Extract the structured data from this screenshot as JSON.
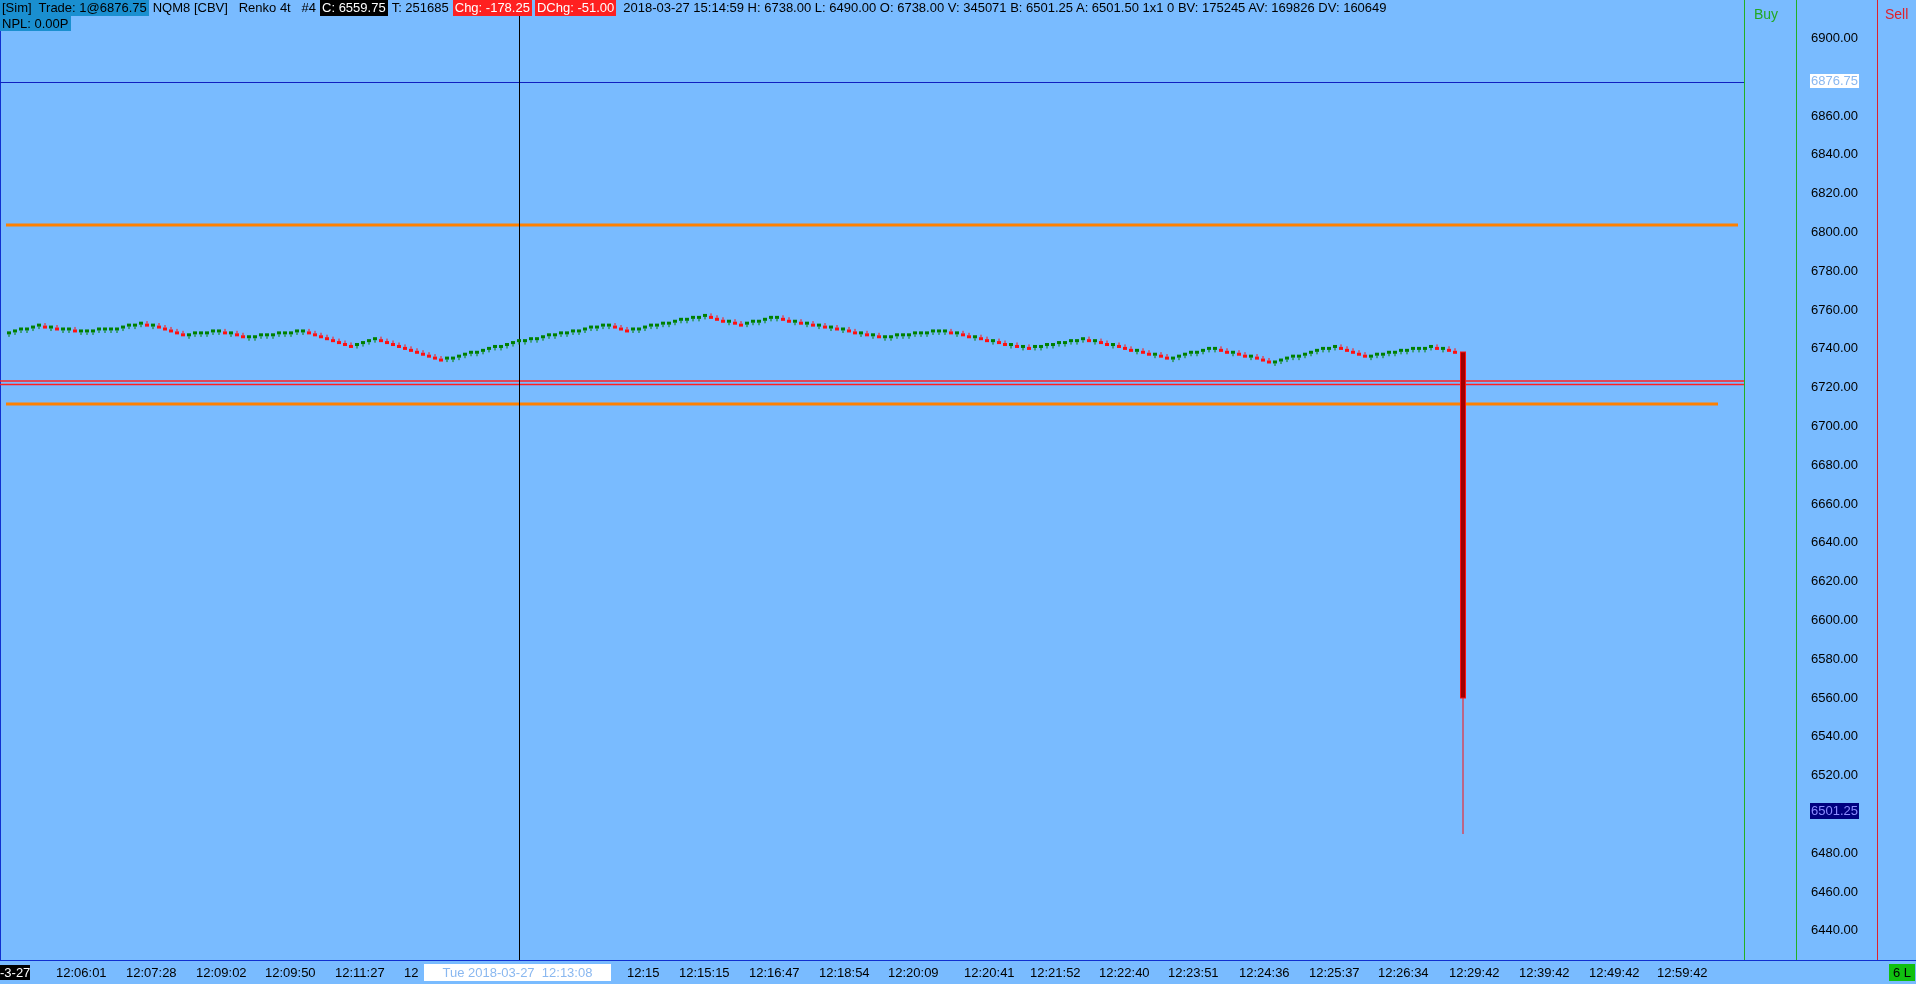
{
  "header": {
    "segments": [
      {
        "kind": "highlight",
        "text": "[Sim]  Trade: 1@6876.75"
      },
      {
        "kind": "plain",
        "text": "NQM8 [CBV]   Renko 4t   #4"
      },
      {
        "kind": "inverse",
        "text": "C: 6559.75"
      },
      {
        "kind": "plain",
        "text": "T: 251685"
      },
      {
        "kind": "alert",
        "text": "Chg: -178.25"
      },
      {
        "kind": "alert",
        "text": "DChg: -51.00"
      },
      {
        "kind": "plain",
        "text": "2018-03-27 15:14:59 H: 6738.00 L: 6490.00 O: 6738.00 V: 345071 B: 6501.25 A: 6501.50 1x1 0 BV: 175245 AV: 169826 DV: 160649"
      }
    ],
    "npl": "NPL: 0.00P"
  },
  "buy_label": "Buy",
  "sell_label": "Sell",
  "price_axis": {
    "labels": [
      "6900.00",
      "6860.00",
      "6840.00",
      "6820.00",
      "6800.00",
      "6780.00",
      "6760.00",
      "6740.00",
      "6720.00",
      "6700.00",
      "6680.00",
      "6660.00",
      "6640.00",
      "6620.00",
      "6600.00",
      "6580.00",
      "6560.00",
      "6540.00",
      "6520.00",
      "6480.00",
      "6460.00",
      "6440.00"
    ],
    "last_trade": "6876.75",
    "bid": "6501.25"
  },
  "time_axis": {
    "date": "-3-27",
    "labels": [
      "12:06:01",
      "12:07:28",
      "12:09:02",
      "12:09:50",
      "12:11:27",
      "12",
      "12:15",
      "12:15:15",
      "12:16:47",
      "12:18:54",
      "12:20:09",
      "12:20:41",
      "12:21:52",
      "12:22:40",
      "12:23:51",
      "12:24:36",
      "12:25:37",
      "12:26:34",
      "12:29:42",
      "12:39:42",
      "12:49:42",
      "12:59:42"
    ],
    "crosshair": "Tue 2018-03-27  12:13:08"
  },
  "position": "6 L"
}
